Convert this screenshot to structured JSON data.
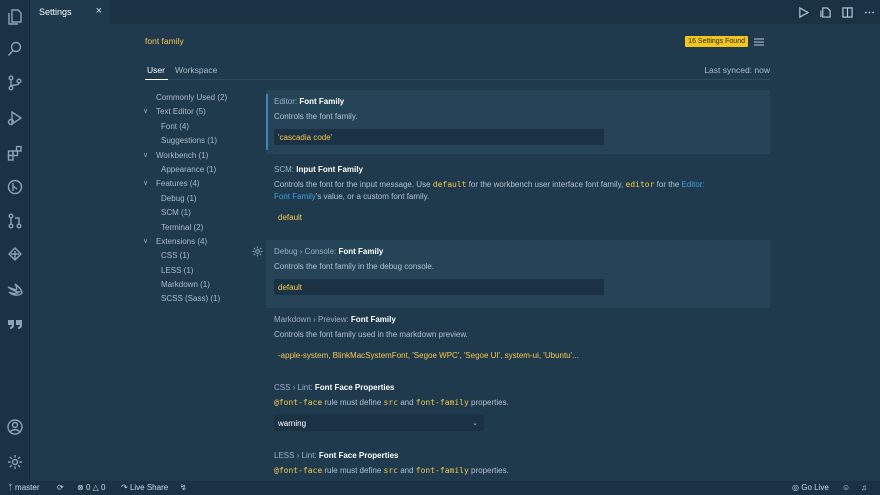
{
  "activity_bar": {
    "icons": [
      "files-icon",
      "search-icon",
      "source-control-icon",
      "run-debug-icon",
      "extensions-icon",
      "git-graph-icon",
      "pull-requests-icon",
      "kubernetes-icon",
      "swift-icon",
      "quote-icon",
      "accounts-icon",
      "settings-gear-icon"
    ]
  },
  "editor_tab": {
    "label": "Settings",
    "close": "×"
  },
  "title_actions": [
    "run-icon",
    "open-json-icon",
    "split-editor-icon",
    "more-icon"
  ],
  "search": {
    "value": "font family",
    "found_badge": "16 Settings Found"
  },
  "scopes": {
    "user": "User",
    "workspace": "Workspace",
    "last_synced": "Last synced: now"
  },
  "toc": [
    {
      "label": "Commonly Used (2)",
      "indent": 0,
      "expandable": false
    },
    {
      "label": "Text Editor (5)",
      "indent": 0,
      "expandable": true
    },
    {
      "label": "Font (4)",
      "indent": 1,
      "expandable": false
    },
    {
      "label": "Suggestions (1)",
      "indent": 1,
      "expandable": false
    },
    {
      "label": "Workbench (1)",
      "indent": 0,
      "expandable": true
    },
    {
      "label": "Appearance (1)",
      "indent": 1,
      "expandable": false
    },
    {
      "label": "Features (4)",
      "indent": 0,
      "expandable": true
    },
    {
      "label": "Debug (1)",
      "indent": 1,
      "expandable": false
    },
    {
      "label": "SCM (1)",
      "indent": 1,
      "expandable": false
    },
    {
      "label": "Terminal (2)",
      "indent": 1,
      "expandable": false
    },
    {
      "label": "Extensions (4)",
      "indent": 0,
      "expandable": true
    },
    {
      "label": "CSS (1)",
      "indent": 1,
      "expandable": false
    },
    {
      "label": "LESS (1)",
      "indent": 1,
      "expandable": false
    },
    {
      "label": "Markdown (1)",
      "indent": 1,
      "expandable": false
    },
    {
      "label": "SCSS (Sass) (1)",
      "indent": 1,
      "expandable": false
    }
  ],
  "settings": {
    "editor": {
      "category": "Editor: ",
      "name": "Font Family",
      "desc": "Controls the font family.",
      "value": "'cascadia code'"
    },
    "scm": {
      "category": "SCM: ",
      "name": "Input Font Family",
      "desc_1": "Controls the font for the input message. Use ",
      "code_1": "default",
      "desc_2": " for the workbench user interface font family, ",
      "code_2": "editor",
      "desc_3": " for the ",
      "link_1": "Editor:",
      "link_2": "Font Family",
      "desc_4": "'s value, or a custom font family.",
      "value": "default"
    },
    "debug": {
      "category": "Debug › Console: ",
      "name": "Font Family",
      "desc": "Controls the font family in the debug console.",
      "value": "default"
    },
    "markdown": {
      "category": "Markdown › Preview: ",
      "name": "Font Family",
      "desc": "Controls the font family used in the markdown preview.",
      "value": "-apple-system, BlinkMacSystemFont, 'Segoe WPC', 'Segoe UI', system-ui, 'Ubuntu'..."
    },
    "css": {
      "category": "CSS › Lint: ",
      "name": "Font Face Properties",
      "code_1": "@font-face",
      "desc_1": " rule must define ",
      "code_2": "src",
      "desc_2": " and ",
      "code_3": "font-family",
      "desc_3": " properties.",
      "value": "warning"
    },
    "less": {
      "category": "LESS › Lint: ",
      "name": "Font Face Properties",
      "code_1": "@font-face",
      "desc_1": " rule must define ",
      "code_2": "src",
      "desc_2": " and ",
      "code_3": "font-family",
      "desc_3": " properties."
    }
  },
  "status_bar": {
    "branch": "master",
    "errors": "0",
    "warnings": "0",
    "live_share": "Live Share",
    "go_live": "Go Live"
  },
  "colors": {
    "accent": "#f5c518",
    "code": "#f5c84c",
    "link": "#3aa0e0",
    "background": "#1f3a4d"
  }
}
